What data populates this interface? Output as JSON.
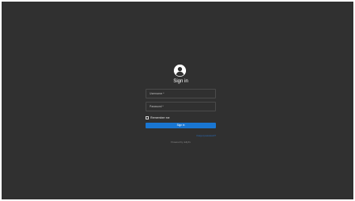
{
  "page": {
    "title": "Sign in"
  },
  "form": {
    "username_placeholder": "Username *",
    "password_placeholder": "Password *",
    "remember_label": "Remember me",
    "signin_label": "Sign in",
    "forgot_label": "Forgot password?",
    "powered_by": "Powered by Jellyfin"
  },
  "icons": {
    "avatar": "user-avatar-icon"
  },
  "colors": {
    "background": "#303030",
    "accent": "#1976d2",
    "link": "#2a6fc0"
  }
}
